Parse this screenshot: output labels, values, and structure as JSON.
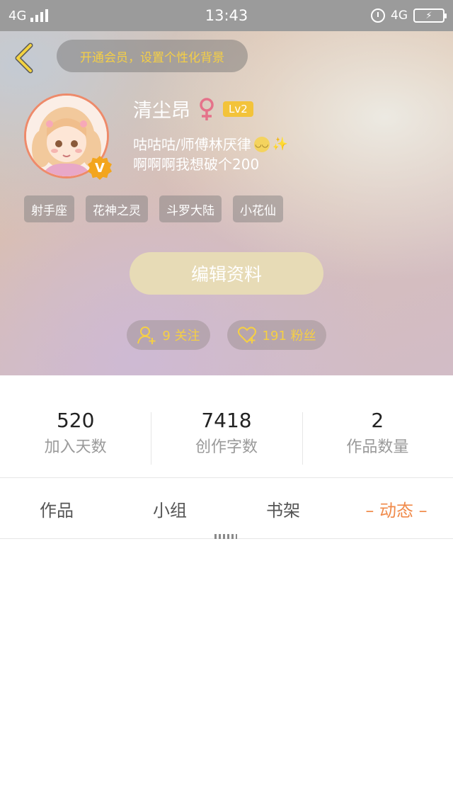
{
  "status_bar": {
    "network_left": "4G",
    "time": "13:43",
    "network_right": "4G"
  },
  "header": {
    "vip_banner": "开通会员，设置个性化背景",
    "username": "清尘昂",
    "gender_symbol": "♀",
    "level": "Lv2",
    "verified_badge": "V",
    "bio_line1": "咕咕咕/师傅林厌律",
    "bio_line2": "啊啊啊我想破个200",
    "tags": [
      "射手座",
      "花神之灵",
      "斗罗大陆",
      "小花仙"
    ],
    "edit_button": "编辑资料",
    "following": "9 关注",
    "followers": "191 粉丝"
  },
  "stats": [
    {
      "value": "520",
      "label": "加入天数"
    },
    {
      "value": "7418",
      "label": "创作字数"
    },
    {
      "value": "2",
      "label": "作品数量"
    }
  ],
  "tabs": [
    "作品",
    "小组",
    "书架",
    "– 动态 –"
  ],
  "active_tab": 3,
  "colors": {
    "accent_orange": "#f08a4a",
    "gold": "#f5cf45",
    "status_bar": "#9b9b9b"
  }
}
